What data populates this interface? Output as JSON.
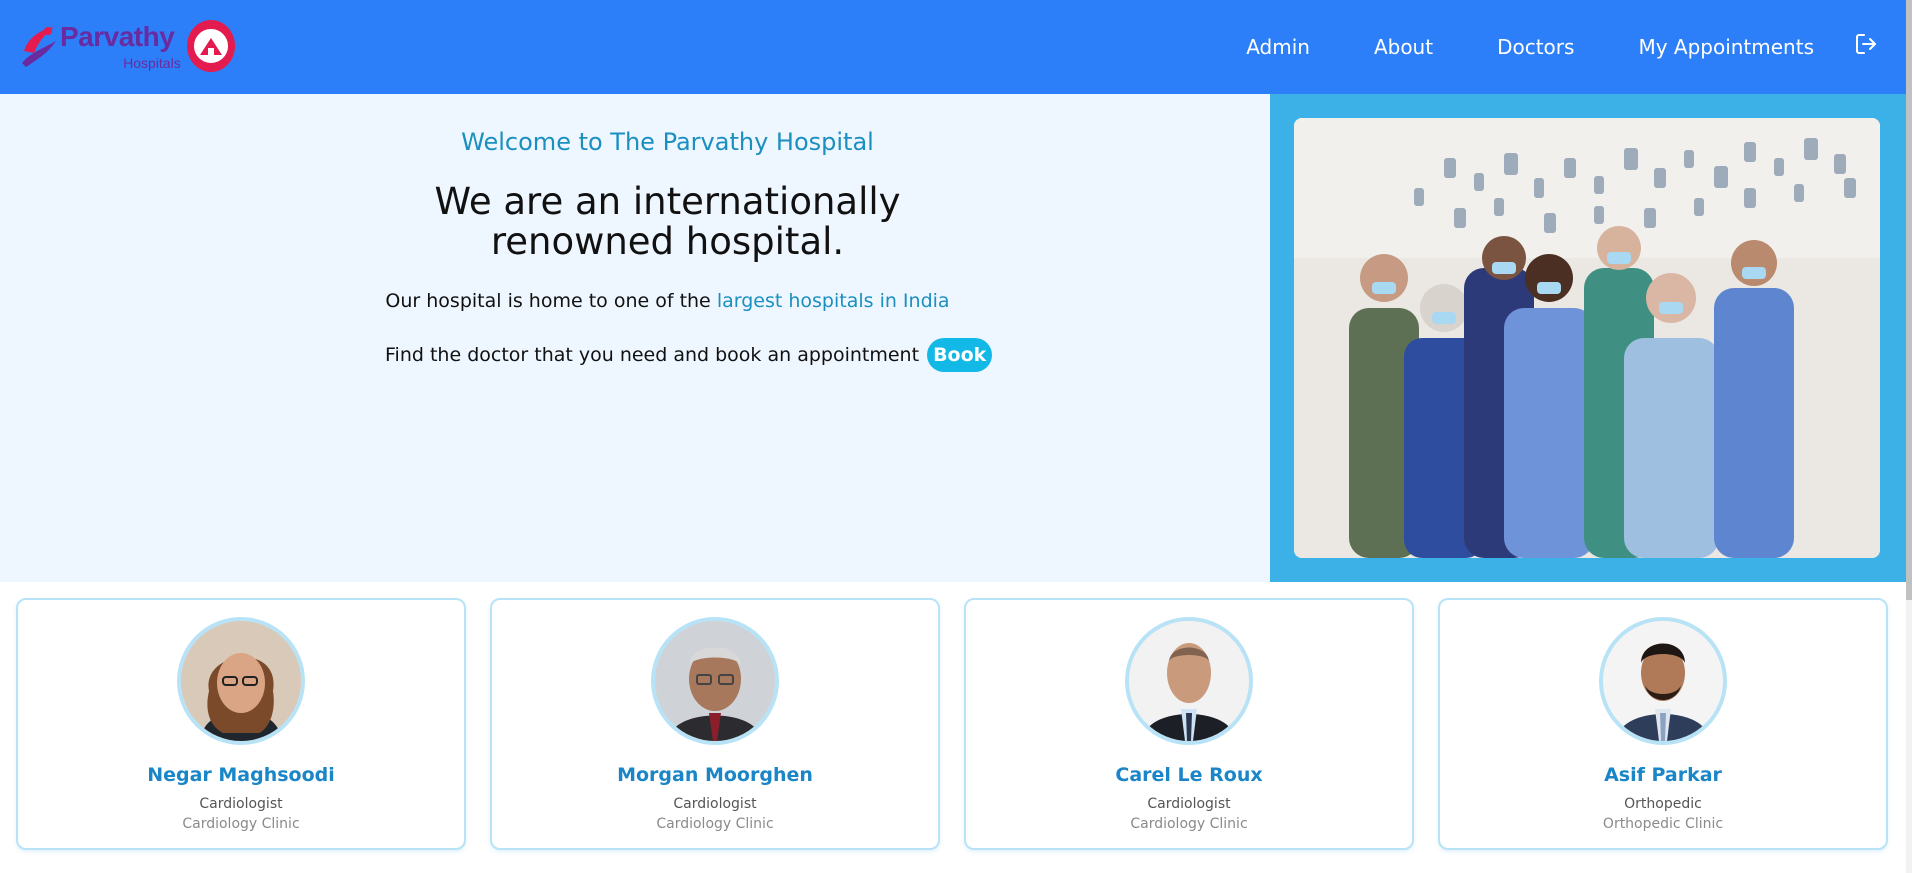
{
  "brand": {
    "name": "Parvathy",
    "sub": "Hospitals",
    "colors": {
      "primary": "#6a2aa0",
      "accent": "#e31b4e"
    }
  },
  "nav": {
    "items": [
      {
        "label": "Admin"
      },
      {
        "label": "About"
      },
      {
        "label": "Doctors"
      },
      {
        "label": "My Appointments"
      }
    ],
    "logout_icon": "logout-icon",
    "bg_color": "#2d7ff9"
  },
  "hero": {
    "welcome": "Welcome to The Parvathy Hospital",
    "heading_line1": "We are an internationally",
    "heading_line2": "renowned hospital.",
    "sub_prefix": "Our hospital is home to one of the",
    "sub_highlight": "largest hospitals in India",
    "find_text": "Find the doctor that you need and book an appointment",
    "book_label": "Book"
  },
  "doctors": [
    {
      "name": "Negar Maghsoodi",
      "specialty": "Cardiologist",
      "clinic": "Cardiology Clinic"
    },
    {
      "name": "Morgan Moorghen",
      "specialty": "Cardiologist",
      "clinic": "Cardiology Clinic"
    },
    {
      "name": "Carel Le Roux",
      "specialty": "Cardiologist",
      "clinic": "Cardiology Clinic"
    },
    {
      "name": "Asif Parkar",
      "specialty": "Orthopedic",
      "clinic": "Orthopedic Clinic"
    }
  ]
}
